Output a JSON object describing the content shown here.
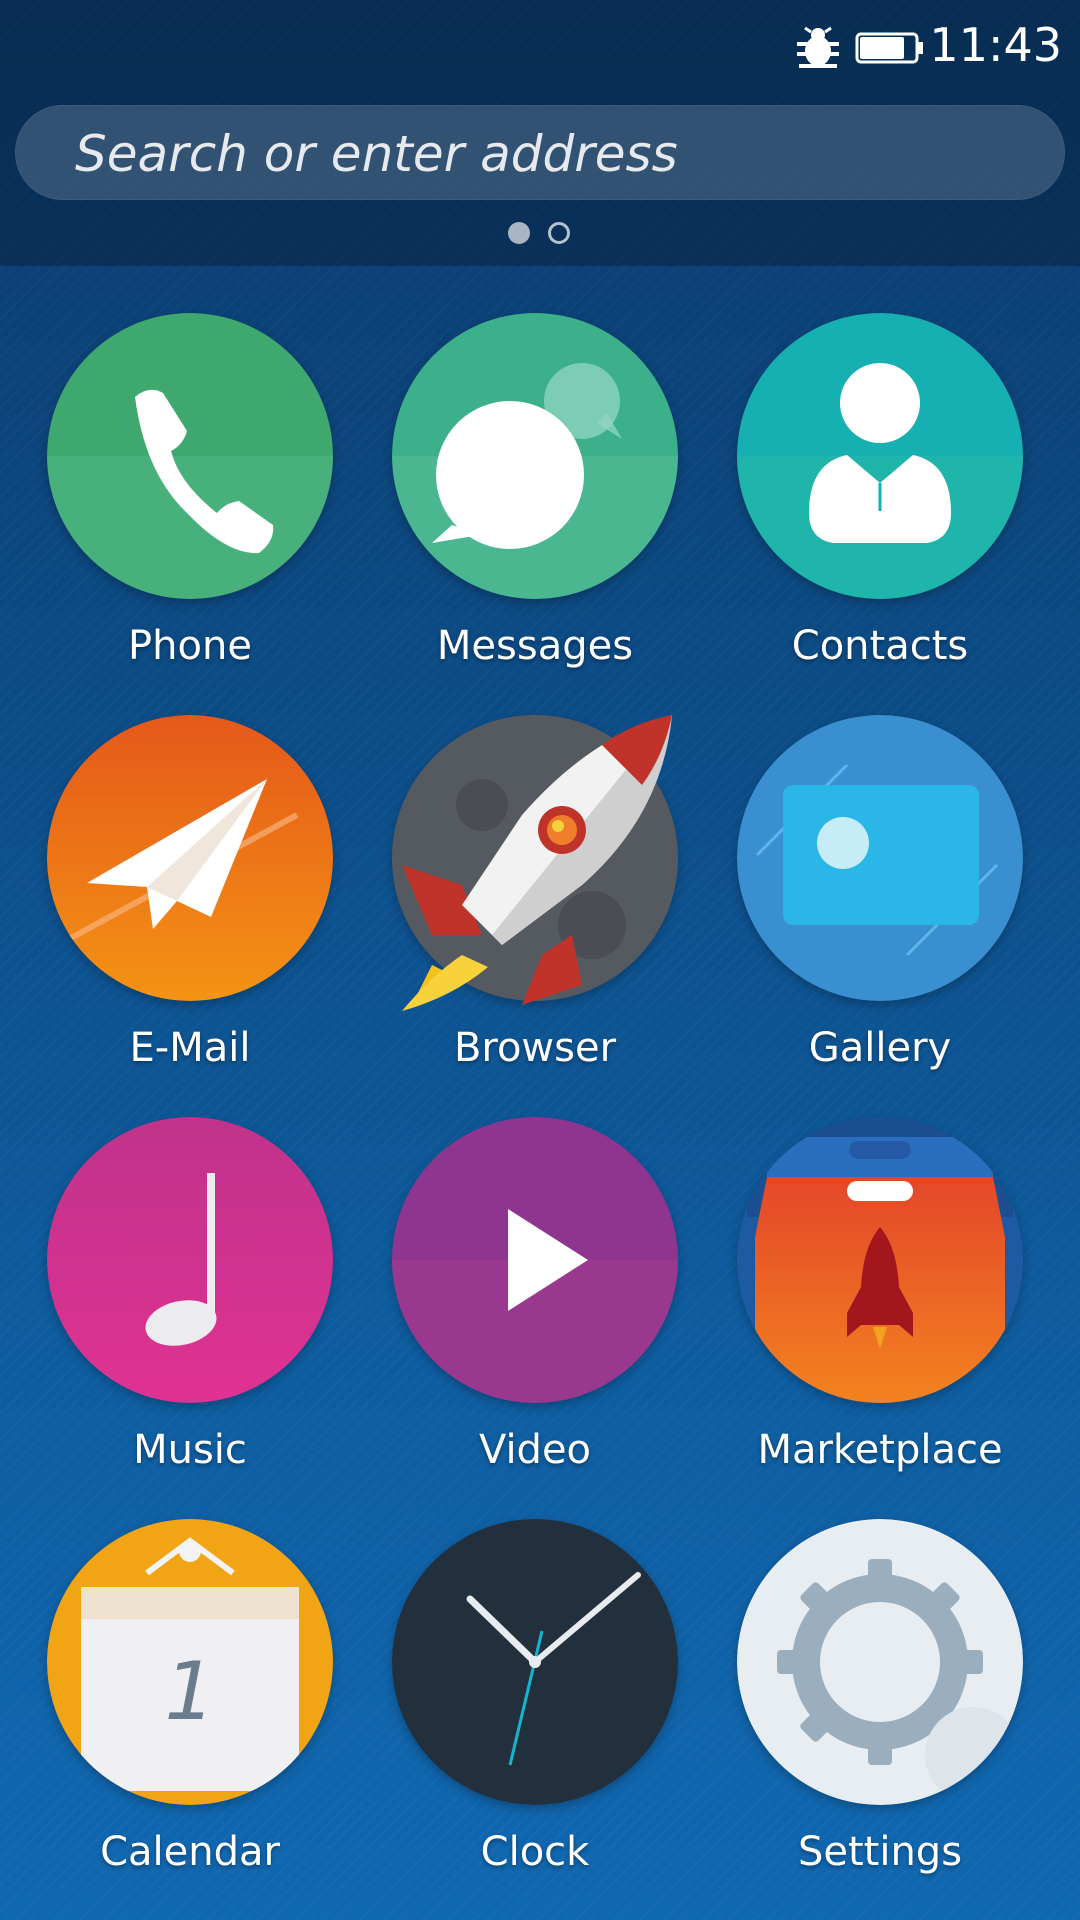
{
  "status_bar": {
    "time": "11:43",
    "icons": [
      "bug-icon",
      "battery-icon"
    ]
  },
  "search": {
    "placeholder": "Search or enter address"
  },
  "pager": {
    "active_page": 1,
    "page_count": 2
  },
  "apps": [
    {
      "label": "Phone",
      "icon": "phone-icon",
      "color": "#3ea86f"
    },
    {
      "label": "Messages",
      "icon": "messages-icon",
      "color": "#3bb08a"
    },
    {
      "label": "Contacts",
      "icon": "contacts-icon",
      "color": "#17b0b2"
    },
    {
      "label": "E-Mail",
      "icon": "email-icon",
      "color": "#ee7a13"
    },
    {
      "label": "Browser",
      "icon": "browser-icon",
      "color": "#555a60"
    },
    {
      "label": "Gallery",
      "icon": "gallery-icon",
      "color": "#3a8fd0"
    },
    {
      "label": "Music",
      "icon": "music-icon",
      "color": "#d8358f"
    },
    {
      "label": "Video",
      "icon": "video-icon",
      "color": "#8e3590"
    },
    {
      "label": "Marketplace",
      "icon": "marketplace-icon",
      "color": "#e8591f"
    },
    {
      "label": "Calendar",
      "icon": "calendar-icon",
      "color": "#f1a414",
      "day": "1"
    },
    {
      "label": "Clock",
      "icon": "clock-icon",
      "color": "#22303e"
    },
    {
      "label": "Settings",
      "icon": "settings-icon",
      "color": "#e8edf1"
    }
  ]
}
